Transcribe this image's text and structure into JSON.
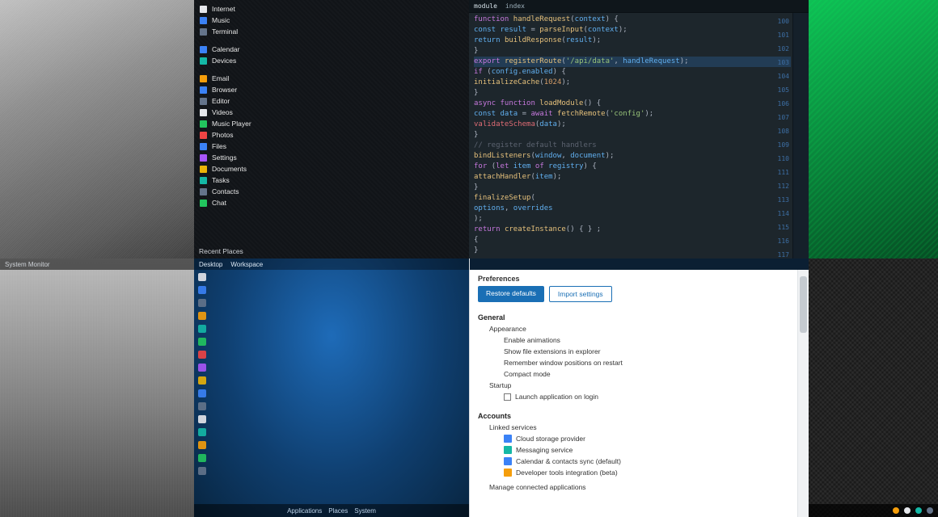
{
  "top_left_wallpaper": {
    "label": "brushed-metal-wallpaper"
  },
  "start_menu": {
    "items_top": [
      {
        "icon": "c-white",
        "label": "Internet"
      },
      {
        "icon": "c-blue",
        "label": "Music"
      },
      {
        "icon": "c-slate",
        "label": "Terminal"
      }
    ],
    "items_mid": [
      {
        "icon": "c-blue",
        "label": "Calendar"
      },
      {
        "icon": "c-teal",
        "label": "Devices"
      }
    ],
    "items_main": [
      {
        "icon": "c-orange",
        "label": "Email"
      },
      {
        "icon": "c-blue",
        "label": "Browser"
      },
      {
        "icon": "c-slate",
        "label": "Editor"
      },
      {
        "icon": "c-white",
        "label": "Videos"
      },
      {
        "icon": "c-green",
        "label": "Music Player"
      },
      {
        "icon": "c-red",
        "label": "Photos"
      },
      {
        "icon": "c-blue",
        "label": "Files"
      },
      {
        "icon": "c-purple",
        "label": "Settings"
      },
      {
        "icon": "c-yellow",
        "label": "Documents"
      },
      {
        "icon": "c-teal",
        "label": "Tasks"
      },
      {
        "icon": "c-slate",
        "label": "Contacts"
      },
      {
        "icon": "c-green",
        "label": "Chat"
      }
    ],
    "footer": "Recent  Places"
  },
  "code": {
    "tab_a": "module",
    "tab_b": "index",
    "ruler": [
      "100",
      "101",
      "102",
      "103",
      "104",
      "105",
      "106",
      "107",
      "108",
      "109",
      "110",
      "111",
      "112",
      "113",
      "114",
      "115",
      "116",
      "117"
    ],
    "lines": [
      [
        [
          "tok-kw",
          "function "
        ],
        [
          "tok-fn",
          "handleRequest"
        ],
        [
          "tok-punc",
          "("
        ],
        [
          "tok-var",
          "context"
        ],
        [
          "tok-punc",
          ") {"
        ]
      ],
      [
        [
          "tok-var",
          "  const "
        ],
        [
          "tok-var",
          "result"
        ],
        [
          "tok-punc",
          " = "
        ],
        [
          "tok-fn",
          "parseInput"
        ],
        [
          "tok-punc",
          "("
        ],
        [
          "tok-var",
          "context"
        ],
        [
          "tok-punc",
          ");"
        ]
      ],
      [
        [
          "tok-var",
          "  return "
        ],
        [
          "tok-fn",
          "buildResponse"
        ],
        [
          "tok-punc",
          "("
        ],
        [
          "tok-var",
          "result"
        ],
        [
          "tok-punc",
          ");"
        ]
      ],
      [
        [
          "tok-punc",
          "}"
        ]
      ],
      [
        [
          "tok-kw",
          "export "
        ],
        [
          "tok-fn",
          "registerRoute"
        ],
        [
          "tok-punc",
          "("
        ],
        [
          "tok-str",
          "'/api/data'"
        ],
        [
          "tok-punc",
          ", "
        ],
        [
          "tok-var",
          "handleRequest"
        ],
        [
          "tok-punc",
          ");"
        ]
      ],
      [
        [
          "tok-kw",
          "if "
        ],
        [
          "tok-punc",
          "("
        ],
        [
          "tok-var",
          "config"
        ],
        [
          "tok-punc",
          "."
        ],
        [
          "tok-var",
          "enabled"
        ],
        [
          "tok-punc",
          ") {"
        ]
      ],
      [
        [
          "tok-fn",
          "  initializeCache"
        ],
        [
          "tok-punc",
          "("
        ],
        [
          "tok-num",
          "1024"
        ],
        [
          "tok-punc",
          ");"
        ]
      ],
      [
        [
          "tok-punc",
          "}"
        ]
      ],
      [
        [
          "tok-kw",
          "async function "
        ],
        [
          "tok-fn",
          "loadModule"
        ],
        [
          "tok-punc",
          "() {"
        ]
      ],
      [
        [
          "tok-var",
          "  const "
        ],
        [
          "tok-var",
          "data"
        ],
        [
          "tok-punc",
          " = "
        ],
        [
          "tok-kw",
          "await "
        ],
        [
          "tok-fn",
          "fetchRemote"
        ],
        [
          "tok-punc",
          "("
        ],
        [
          "tok-str",
          "'config'"
        ],
        [
          "tok-punc",
          ");"
        ]
      ],
      [
        [
          "tok-err",
          "  validateSchema"
        ],
        [
          "tok-punc",
          "("
        ],
        [
          "tok-var",
          "data"
        ],
        [
          "tok-punc",
          ");"
        ]
      ],
      [
        [
          "tok-punc",
          "}"
        ]
      ],
      [
        [
          "tok-cmt",
          "// register default handlers"
        ]
      ],
      [
        [
          "tok-fn",
          "bindListeners"
        ],
        [
          "tok-punc",
          "("
        ],
        [
          "tok-var",
          "window"
        ],
        [
          "tok-punc",
          ", "
        ],
        [
          "tok-var",
          "document"
        ],
        [
          "tok-punc",
          ");"
        ]
      ],
      [
        [
          "tok-kw",
          "for "
        ],
        [
          "tok-punc",
          "("
        ],
        [
          "tok-kw",
          "let "
        ],
        [
          "tok-var",
          "item"
        ],
        [
          "tok-kw",
          " of "
        ],
        [
          "tok-var",
          "registry"
        ],
        [
          "tok-punc",
          ") {"
        ]
      ],
      [
        [
          "tok-fn",
          "  attachHandler"
        ],
        [
          "tok-punc",
          "("
        ],
        [
          "tok-var",
          "item"
        ],
        [
          "tok-punc",
          ");"
        ]
      ],
      [
        [
          "tok-punc",
          "}"
        ]
      ],
      [
        [
          "tok-fn",
          "finalizeSetup"
        ],
        [
          "tok-punc",
          "("
        ]
      ],
      [
        [
          "tok-var",
          "  options"
        ],
        [
          "tok-punc",
          ", "
        ],
        [
          "tok-var",
          "overrides"
        ]
      ],
      [
        [
          "tok-punc",
          ");"
        ]
      ],
      [
        [
          "tok-kw",
          "return "
        ],
        [
          "tok-fn",
          "createInstance"
        ],
        [
          "tok-punc",
          "("
        ],
        [
          "tok-punc",
          ") "
        ],
        [
          "tok-punc",
          "{ } ;"
        ]
      ],
      [
        [
          "tok-punc",
          "{"
        ]
      ],
      [
        [
          "tok-punc",
          "}"
        ]
      ]
    ],
    "highlight_index": 4
  },
  "bottom_metal_strip": "System  Monitor",
  "blue": {
    "title_a": "Desktop",
    "title_b": "Workspace",
    "taskbar_items": [
      "Applications",
      "Places",
      "System"
    ],
    "dock_icons": [
      "c-white",
      "c-blue",
      "c-slate",
      "c-orange",
      "c-teal",
      "c-green",
      "c-red",
      "c-purple",
      "c-yellow",
      "c-blue",
      "c-slate",
      "c-white",
      "c-teal",
      "c-orange",
      "c-green",
      "c-slate"
    ]
  },
  "settings": {
    "header": "Preferences",
    "btn_primary": "Restore defaults",
    "btn_secondary": "Import settings",
    "section_a": "General",
    "group_a_parent": "Appearance",
    "group_a_items": [
      "Enable animations",
      "Show file extensions in explorer",
      "Remember window positions on restart",
      "Compact mode"
    ],
    "group_b_label": "Startup",
    "group_b_check": "Launch application on login",
    "section_b": "Accounts",
    "acc_parent": "Linked services",
    "acc_items": [
      {
        "icon": "c-blue",
        "label": "Cloud storage provider"
      },
      {
        "icon": "c-teal",
        "label": "Messaging service"
      },
      {
        "icon": "c-blue",
        "label": "Calendar & contacts sync (default)"
      },
      {
        "icon": "c-orange",
        "label": "Developer tools integration (beta)"
      }
    ],
    "acc_footer": "Manage connected applications"
  },
  "tray_icons": [
    "c-orange",
    "c-white",
    "c-teal",
    "c-slate"
  ]
}
